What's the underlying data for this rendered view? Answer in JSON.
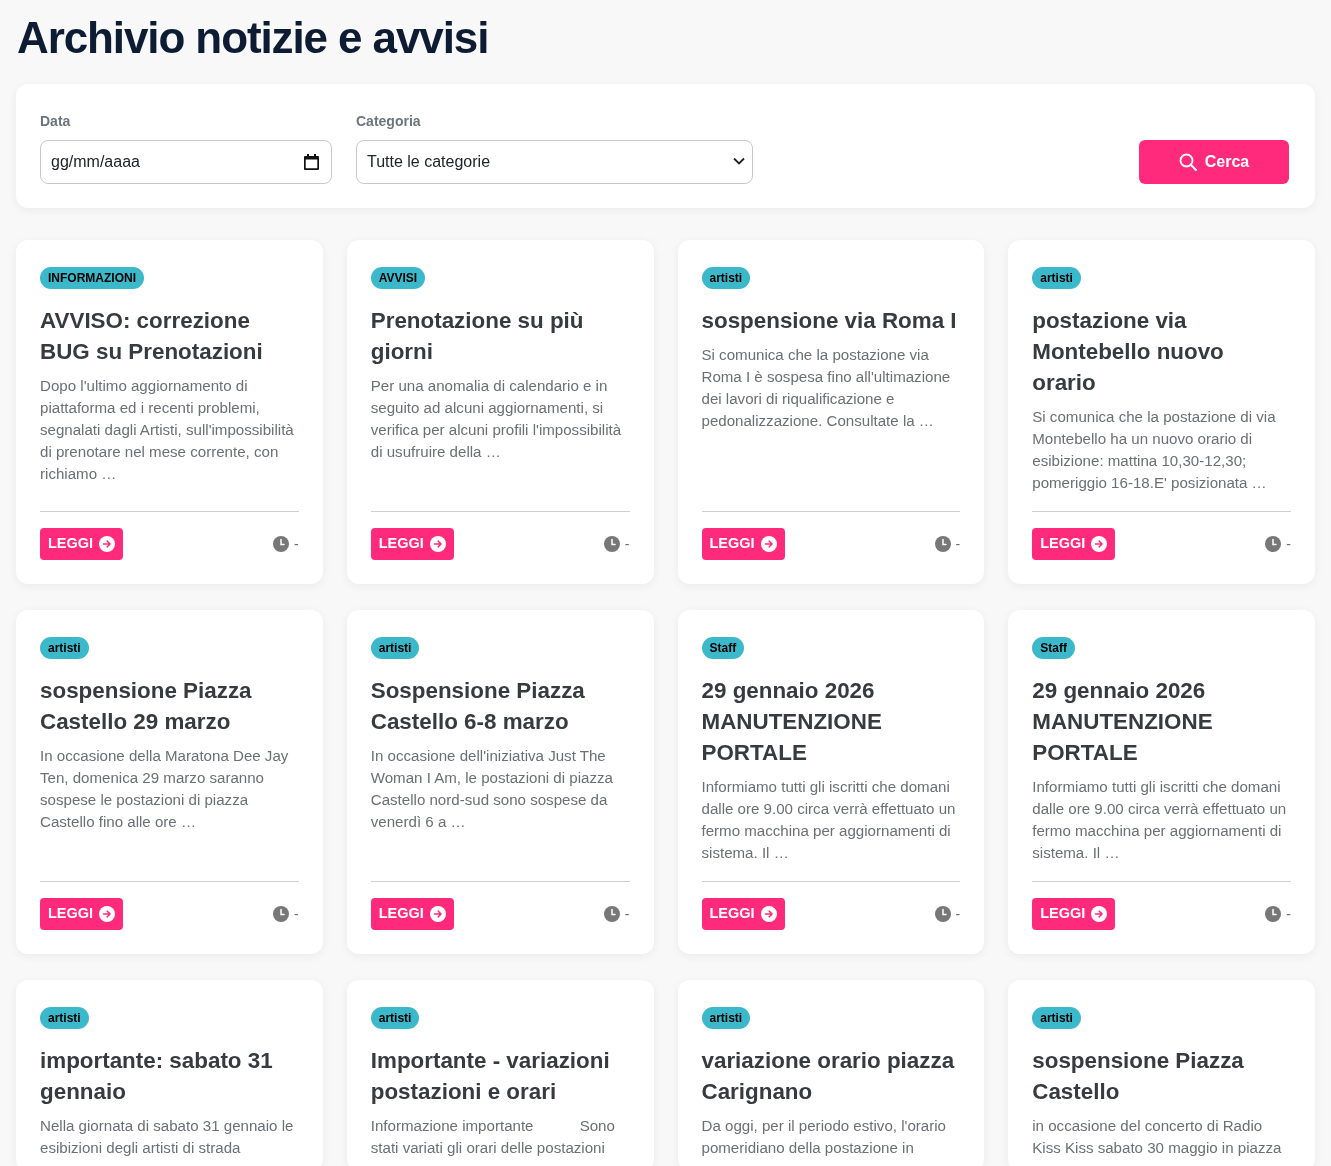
{
  "page": {
    "title": "Archivio notizie e avvisi"
  },
  "filters": {
    "fields": [
      {
        "kind": "date",
        "label": "Data",
        "placeholder": "gg/mm/aaaa"
      },
      {
        "kind": "select",
        "label": "Categoria",
        "value": "Tutte le categorie"
      }
    ],
    "search_button": "Cerca"
  },
  "news": [
    {
      "category": "INFORMAZIONI",
      "title": "AVVISO: correzione BUG su Prenotazioni",
      "excerpt": "Dopo l'ultimo aggiornamento di piattaforma ed i recenti problemi, segnalati dagli Artisti, sull'impossibilità di prenotare nel mese corrente, con richiamo …",
      "button": "LEGGI",
      "date": "-"
    },
    {
      "category": "AVVISI",
      "title": "Prenotazione su più giorni",
      "excerpt": "Per una anomalia di calendario e in seguito ad alcuni aggiornamenti, si verifica per alcuni profili l'impossibilità di usufruire della …",
      "button": "LEGGI",
      "date": "-"
    },
    {
      "category": "artisti",
      "title": "sospensione via Roma I",
      "excerpt": "Si comunica che la postazione via Roma I è sospesa fino all'ultimazione dei lavori di riqualificazione e pedonalizzazione. Consultate la …",
      "button": "LEGGI",
      "date": "-"
    },
    {
      "category": "artisti",
      "title": "postazione via Montebello nuovo orario",
      "excerpt": "Si comunica che la postazione di via Montebello ha un nuovo orario di esibizione: mattina 10,30-12,30; pomeriggio 16-18.E' posizionata …",
      "button": "LEGGI",
      "date": "-"
    },
    {
      "category": "artisti",
      "title": "sospensione Piazza Castello 29 marzo",
      "excerpt": "In occasione della Maratona Dee Jay Ten, domenica 29 marzo saranno sospese le postazioni di piazza Castello fino alle ore …",
      "button": "LEGGI",
      "date": "-"
    },
    {
      "category": "artisti",
      "title": "Sospensione Piazza Castello 6-8 marzo",
      "excerpt": "In occasione dell'iniziativa Just The Woman I Am, le postazioni di piazza Castello nord-sud sono sospese da venerdì 6 a …",
      "button": "LEGGI",
      "date": "-"
    },
    {
      "category": "Staff",
      "title": "29 gennaio 2026 MANUTENZIONE PORTALE",
      "excerpt": "Informiamo tutti gli iscritti che domani dalle ore 9.00 circa verrà effettuato un fermo macchina per aggiornamenti di sistema. Il …",
      "button": "LEGGI",
      "date": "-"
    },
    {
      "category": "Staff",
      "title": "29 gennaio 2026 MANUTENZIONE PORTALE",
      "excerpt": "Informiamo tutti gli iscritti che domani dalle ore 9.00 circa verrà effettuato un fermo macchina per aggiornamenti di sistema. Il …",
      "button": "LEGGI",
      "date": "-"
    },
    {
      "category": "artisti",
      "title": "importante: sabato 31 gennaio",
      "excerpt": "Nella giornata di sabato 31 gennaio le esibizioni degli artisti di strada"
    },
    {
      "category": "artisti",
      "title": "Importante - variazioni postazioni e orari",
      "excerpt": "Informazione importante           Sono stati variati gli orari delle postazioni"
    },
    {
      "category": "artisti",
      "title": "variazione orario piazza Carignano",
      "excerpt": "Da oggi, per il periodo estivo, l'orario pomeridiano della postazione in"
    },
    {
      "category": "artisti",
      "title": "sospensione Piazza Castello",
      "excerpt": "in occasione del concerto di Radio Kiss Kiss sabato 30 maggio in piazza"
    }
  ]
}
